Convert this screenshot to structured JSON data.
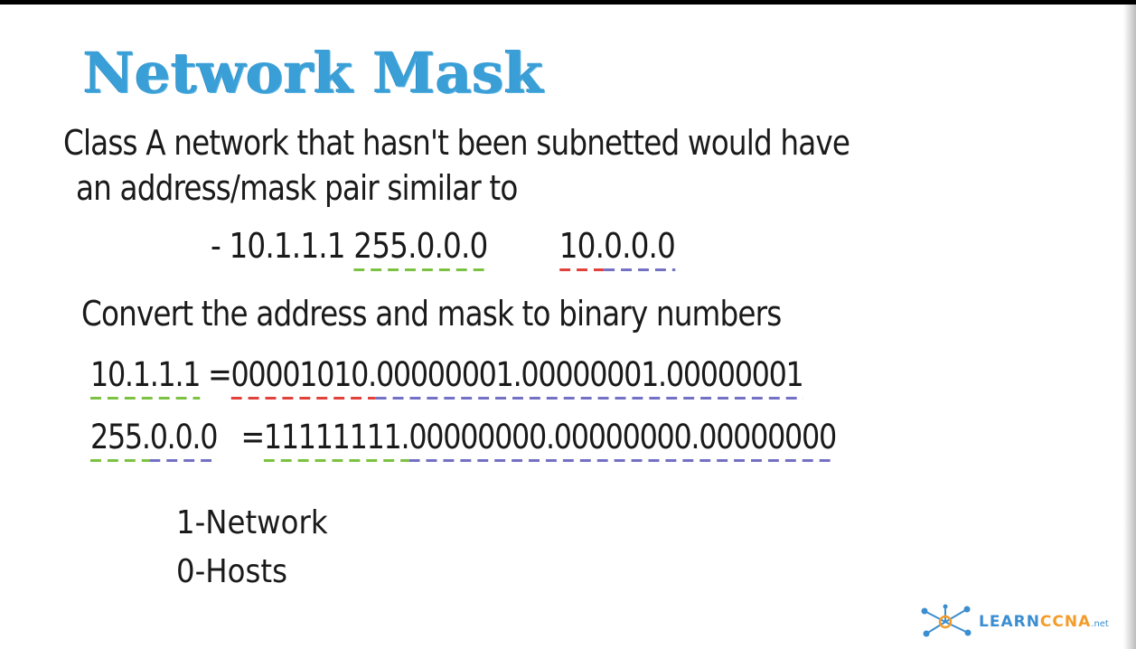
{
  "slide": {
    "title": "Network Mask",
    "line1": "Class A network that hasn't been subnetted would have",
    "line2": "an address/mask pair similar to",
    "example": {
      "dash": "-",
      "address": "10.1.1.1",
      "mask": "255.0.0.0",
      "network": {
        "first": "10.",
        "rest": "0.0.0"
      }
    },
    "line4": "Convert the address and mask to binary numbers",
    "binary_address": {
      "decimal": "10.1.1.1",
      "equals": "=",
      "first": "00001010.",
      "rest": "00000001.00000001.00000001"
    },
    "binary_mask": {
      "decimal": {
        "first": "255.",
        "rest": "0.0.0"
      },
      "equals": "=",
      "first": "11111111.",
      "rest": "00000000.00000000.00000000"
    },
    "legend": {
      "network": "1-Network",
      "hosts": "0-Hosts"
    }
  },
  "logo": {
    "icon": "network-nodes-icon",
    "text_a": "LEARN",
    "text_b": "CCNA",
    "text_c": ".net"
  },
  "colors": {
    "title": "#3a9fd6",
    "underline_green": "#7cc242",
    "underline_red": "#e0413a",
    "underline_blue": "#7470c4",
    "logo_blue": "#3b8ed0",
    "logo_orange": "#f39c2a"
  }
}
